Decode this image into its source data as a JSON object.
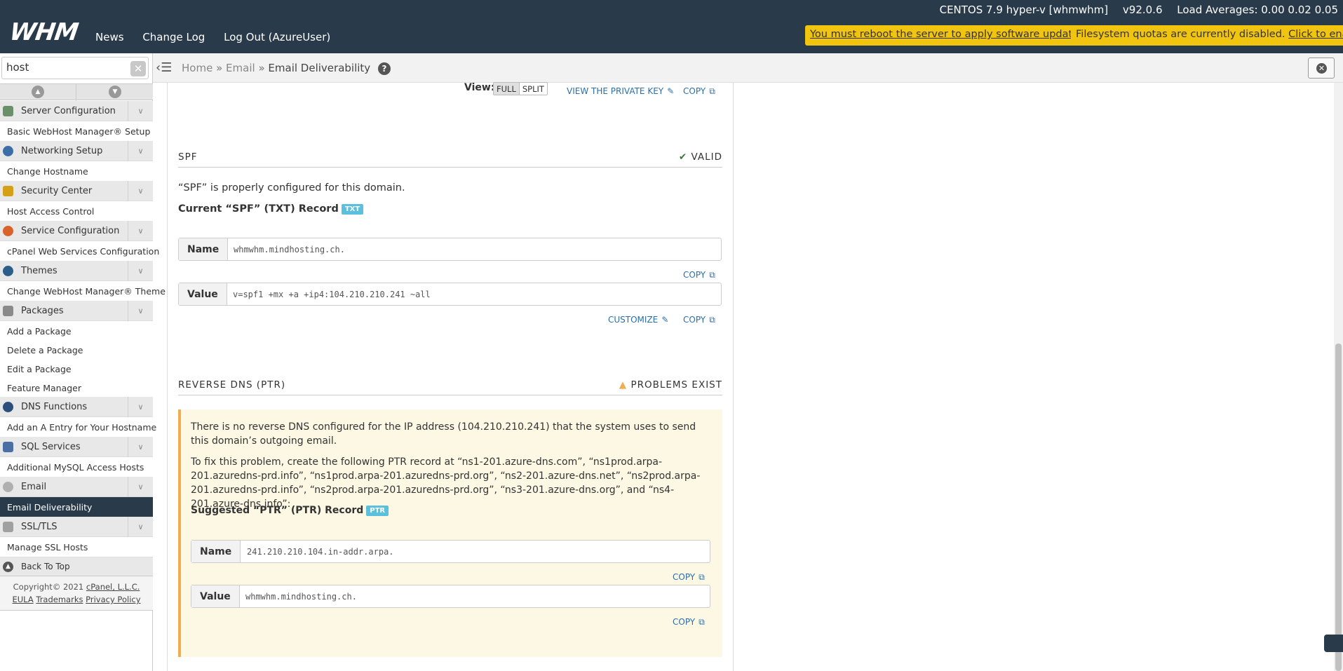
{
  "topbar": {
    "logo": "WHM",
    "nav": [
      "News",
      "Change Log",
      "Log Out (AzureUser)"
    ],
    "os": "CENTOS 7.9 hyper-v [whmwhm]",
    "version": "v92.0.6",
    "load": "Load Averages: 0.00 0.02 0.05",
    "notice_reboot": "You must reboot the server to apply software updates.",
    "notice_quota_text": "Filesystem quotas are currently disabled.",
    "notice_quota_link": "Click to enable."
  },
  "sidebar": {
    "search_value": "host",
    "categories": [
      {
        "label": "Server Configuration",
        "items": [
          "Basic WebHost Manager® Setup"
        ]
      },
      {
        "label": "Networking Setup",
        "items": [
          "Change Hostname"
        ]
      },
      {
        "label": "Security Center",
        "items": [
          "Host Access Control"
        ]
      },
      {
        "label": "Service Configuration",
        "items": [
          "cPanel Web Services Configuration"
        ]
      },
      {
        "label": "Themes",
        "items": [
          "Change WebHost Manager® Theme"
        ]
      },
      {
        "label": "Packages",
        "items": [
          "Add a Package",
          "Delete a Package",
          "Edit a Package",
          "Feature Manager"
        ]
      },
      {
        "label": "DNS Functions",
        "items": [
          "Add an A Entry for Your Hostname"
        ]
      },
      {
        "label": "SQL Services",
        "items": [
          "Additional MySQL Access Hosts"
        ]
      },
      {
        "label": "Email",
        "items": [
          "Email Deliverability"
        ]
      },
      {
        "label": "SSL/TLS",
        "items": [
          "Manage SSL Hosts"
        ]
      }
    ],
    "back_to_top": "Back To Top",
    "copyright": "Copyright© 2021",
    "company": "cPanel, L.L.C.",
    "eula": "EULA",
    "trademarks": "Trademarks",
    "privacy": "Privacy Policy"
  },
  "breadcrumb": {
    "home": "Home",
    "email": "Email",
    "current": "Email Deliverability",
    "sep": "»",
    "help": "?"
  },
  "dkim": {
    "view_label": "View:",
    "full": "FULL",
    "split": "SPLIT",
    "view_private_key": "VIEW THE PRIVATE KEY",
    "copy": "COPY"
  },
  "spf": {
    "title": "SPF",
    "status": "VALID",
    "message": "“SPF” is properly configured for this domain.",
    "record_heading": "Current “SPF” (TXT) Record",
    "badge": "TXT",
    "name_label": "Name",
    "name_value": "whmwhm.mindhosting.ch.",
    "value_label": "Value",
    "value_value": "v=spf1 +mx +a +ip4:104.210.210.241 ~all",
    "copy": "COPY",
    "customize": "CUSTOMIZE"
  },
  "ptr": {
    "title": "REVERSE DNS (PTR)",
    "status": "PROBLEMS EXIST",
    "problem": "There is no reverse DNS configured for the IP address (104.210.210.241) that the system uses to send this domain’s outgoing email.",
    "fix": "To fix this problem, create the following PTR record at “ns1-201.azure-dns.com”, “ns1prod.arpa-201.azuredns-prd.info”, “ns1prod.arpa-201.azuredns-prd.org”, “ns2-201.azure-dns.net”, “ns2prod.arpa-201.azuredns-prd.info”, “ns2prod.arpa-201.azuredns-prd.org”, “ns3-201.azure-dns.org”, and “ns4-201.azure-dns.info”:",
    "record_heading": "Suggested “PTR” (PTR) Record",
    "badge": "PTR",
    "name_label": "Name",
    "name_value": "241.210.210.104.in-addr.arpa.",
    "value_label": "Value",
    "value_value": "whmwhm.mindhosting.ch.",
    "copy": "COPY"
  },
  "colors": {
    "header": "#293a4a",
    "notice": "#f1c40f",
    "link": "#2a6ea8",
    "valid": "#3c763d",
    "warn": "#f0ad4e"
  }
}
